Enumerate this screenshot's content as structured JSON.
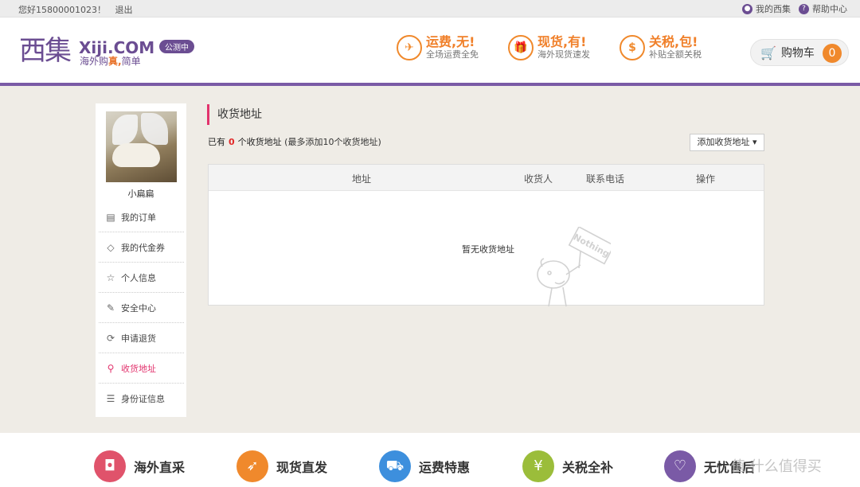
{
  "topbar": {
    "greeting": "您好15800001023！",
    "logout": "退出",
    "my_xiji": "我的西集",
    "help": "帮助中心"
  },
  "header": {
    "logo_cn": "西集",
    "logo_en": "Xiji.COM",
    "slogan_prefix": "海外购",
    "slogan_highlight": "真,",
    "slogan_suffix": "简单",
    "beta_badge": "公测中",
    "promos": [
      {
        "title": "运费,无!",
        "sub": "全场运费全免",
        "icon": "plane-icon"
      },
      {
        "title": "现货,有!",
        "sub": "海外现货速发",
        "icon": "gift-icon"
      },
      {
        "title": "关税,包!",
        "sub": "补贴全额关税",
        "icon": "dollar-icon"
      }
    ],
    "cart_label": "购物车",
    "cart_count": "0"
  },
  "sidebar": {
    "username": "小扁扁",
    "items": [
      {
        "label": "我的订单",
        "icon": "order-list-icon",
        "active": false
      },
      {
        "label": "我的代金券",
        "icon": "coupon-tag-icon",
        "active": false
      },
      {
        "label": "个人信息",
        "icon": "star-icon",
        "active": false
      },
      {
        "label": "安全中心",
        "icon": "edit-icon",
        "active": false
      },
      {
        "label": "申请退货",
        "icon": "refresh-icon",
        "active": false
      },
      {
        "label": "收货地址",
        "icon": "location-pin-icon",
        "active": true
      },
      {
        "label": "身份证信息",
        "icon": "id-card-icon",
        "active": false
      }
    ]
  },
  "main": {
    "title": "收货地址",
    "summary_prefix": "已有",
    "count": "0",
    "summary_suffix": "个收货地址",
    "summary_note": "(最多添加10个收货地址)",
    "add_button": "添加收货地址 ▾",
    "columns": [
      "地址",
      "收货人",
      "联系电话",
      "操作"
    ],
    "empty_text": "暂无收货地址",
    "nothing_sign": "Nothing"
  },
  "footer": {
    "features": [
      {
        "label": "海外直采",
        "color": "#e0536b",
        "icon": "bag-icon"
      },
      {
        "label": "现货直发",
        "color": "#f0892c",
        "icon": "rocket-icon"
      },
      {
        "label": "运费特惠",
        "color": "#3d8fdd",
        "icon": "truck-icon"
      },
      {
        "label": "关税全补",
        "color": "#9bbd3a",
        "icon": "piggy-bank-icon"
      },
      {
        "label": "无忧售后",
        "color": "#7a5aa6",
        "icon": "heart-shield-icon"
      }
    ]
  },
  "watermark": "值 什么值得买",
  "colors": {
    "brand_purple": "#6b4d92",
    "accent_orange": "#f0892c",
    "active_pink": "#e2336d",
    "count_red": "#e12828"
  }
}
